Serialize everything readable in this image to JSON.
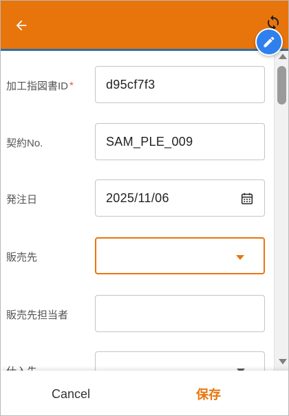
{
  "header": {
    "background_color": "#e8750c",
    "back_icon": "arrow-left-icon",
    "refresh_icon": "refresh-icon",
    "edit_icon": "pencil-icon",
    "edit_button_color": "#2f80ed"
  },
  "form": {
    "fields": [
      {
        "label": "加工指図書ID",
        "required": true,
        "required_mark": "*",
        "value": "d95cf7f3",
        "type": "text"
      },
      {
        "label": "契約No.",
        "required": false,
        "value": "SAM_PLE_009",
        "type": "text"
      },
      {
        "label": "発注日",
        "required": false,
        "value": "2025/11/06",
        "type": "date",
        "icon": "calendar-icon"
      },
      {
        "label": "販売先",
        "required": false,
        "value": "",
        "type": "select",
        "focused": true,
        "icon": "caret-down-icon"
      },
      {
        "label": "販売先担当者",
        "required": false,
        "value": "",
        "type": "text"
      },
      {
        "label": "仕入先",
        "required": false,
        "value": "",
        "type": "select",
        "icon": "caret-down-icon"
      }
    ]
  },
  "footer": {
    "cancel_label": "Cancel",
    "save_label": "保存",
    "save_color": "#e8750c"
  },
  "colors": {
    "accent": "#e8750c",
    "required": "#e25a4a",
    "border": "#c4c4c4"
  }
}
